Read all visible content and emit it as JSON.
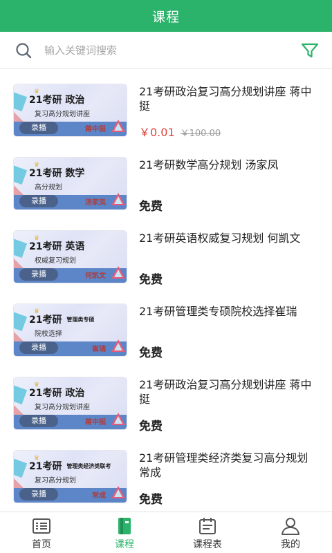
{
  "header": {
    "title": "课程"
  },
  "search": {
    "placeholder": "输入关键词搜索",
    "icon": "search-icon",
    "filter_icon": "filter-icon"
  },
  "colors": {
    "accent": "#2cb36b",
    "price": "#e0413a"
  },
  "courses": [
    {
      "name": "21考研政治复习高分规划讲座  蒋中挺",
      "price": "￥0.01",
      "original_price": "￥100.00",
      "free": "",
      "thumb": {
        "brand": "21考研",
        "subject": "政治",
        "subject_small": "",
        "tagline": "复习高分规划讲座",
        "badge": "录播",
        "teacher": "蒋中挺"
      }
    },
    {
      "name": "21考研数学高分规划  汤家凤",
      "price": "",
      "original_price": "",
      "free": "免费",
      "thumb": {
        "brand": "21考研",
        "subject": "数学",
        "subject_small": "",
        "tagline": "高分规划",
        "badge": "录播",
        "teacher": "汤家凤"
      }
    },
    {
      "name": "21考研英语权威复习规划   何凯文",
      "price": "",
      "original_price": "",
      "free": "免费",
      "thumb": {
        "brand": "21考研",
        "subject": "英语",
        "subject_small": "",
        "tagline": "权威复习规划",
        "badge": "录播",
        "teacher": "何凯文"
      }
    },
    {
      "name": "21考研管理类专硕院校选择崔瑞",
      "price": "",
      "original_price": "",
      "free": "免费",
      "thumb": {
        "brand": "21考研",
        "subject": "",
        "subject_small": "管理类专硕",
        "tagline": "院校选择",
        "badge": "录播",
        "teacher": "崔瑞"
      }
    },
    {
      "name": "21考研政治复习高分规划讲座 蒋中挺",
      "price": "",
      "original_price": "",
      "free": "免费",
      "thumb": {
        "brand": "21考研",
        "subject": "政治",
        "subject_small": "",
        "tagline": "复习高分规划讲座",
        "badge": "录播",
        "teacher": "蒋中挺"
      }
    },
    {
      "name": "21考研管理类经济类复习高分规划  常成",
      "price": "",
      "original_price": "",
      "free": "免费",
      "thumb": {
        "brand": "21考研",
        "subject": "",
        "subject_small": "管理类经济类联考",
        "tagline": "复习高分规划",
        "badge": "录播",
        "teacher": "常成"
      }
    }
  ],
  "tabs": [
    {
      "label": "首页",
      "icon": "home-list-icon",
      "active": false
    },
    {
      "label": "课程",
      "icon": "book-icon",
      "active": true
    },
    {
      "label": "课程表",
      "icon": "schedule-icon",
      "active": false
    },
    {
      "label": "我的",
      "icon": "user-icon",
      "active": false
    }
  ]
}
